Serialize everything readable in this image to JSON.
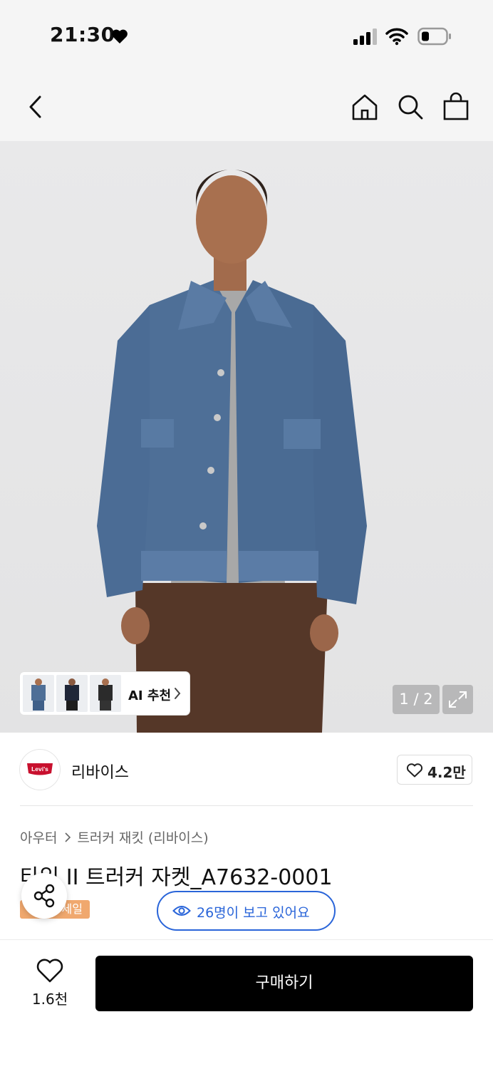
{
  "status_bar": {
    "time": "21:30"
  },
  "header": {
    "icons": [
      "chevron-left-icon",
      "home-icon",
      "search-icon",
      "shopping-bag-icon"
    ]
  },
  "gallery": {
    "ai_recommend_label": "AI 추천",
    "pager": "1 / 2"
  },
  "brand": {
    "name": "리바이스",
    "logo_text": "Levi's",
    "likes": "4.2만"
  },
  "product": {
    "breadcrumb": [
      "아우터",
      "트러커 재킷 (리바이스)"
    ],
    "title": "타입 II 트러커 자켓_A7632-0001",
    "badge": "세일",
    "viewers": "26명이 보고 있어요"
  },
  "bottom_bar": {
    "wishlist_count": "1.6천",
    "buy_label": "구매하기"
  },
  "colors": {
    "accent_blue": "#2a65d9",
    "sale_orange": "#f0a86e",
    "levis_red": "#c8102e",
    "buy_black": "#000000"
  }
}
